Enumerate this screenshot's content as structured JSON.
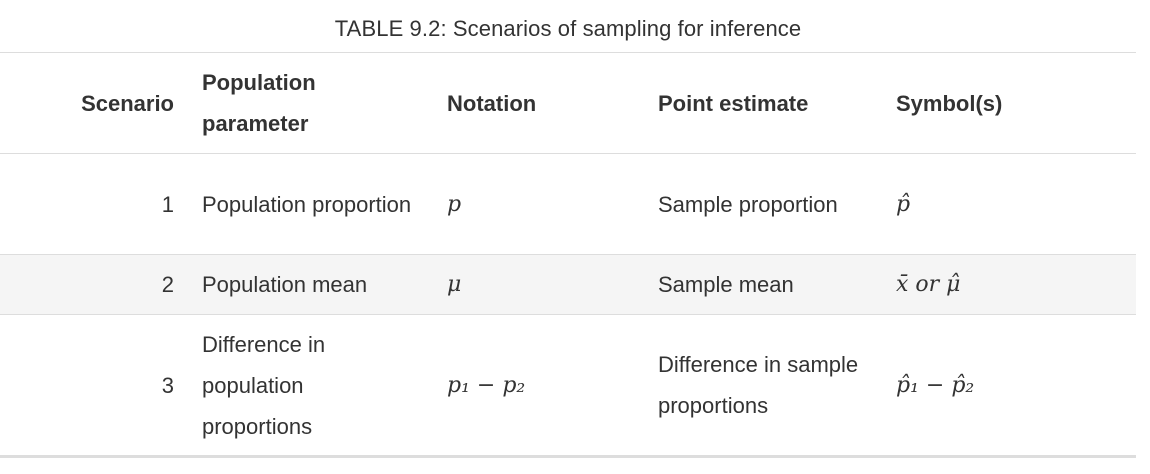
{
  "caption": "TABLE 9.2: Scenarios of sampling for inference",
  "table": {
    "headers": {
      "scenario": "Scenario",
      "parameter": "Population parameter",
      "notation": "Notation",
      "point_estimate": "Point estimate",
      "symbols": "Symbol(s)"
    },
    "rows": [
      {
        "scenario": "1",
        "parameter": "Population proportion",
        "notation": "p",
        "point_estimate": "Sample proportion",
        "symbols": "p̂"
      },
      {
        "scenario": "2",
        "parameter": "Population mean",
        "notation": "μ",
        "point_estimate": "Sample mean",
        "symbols": "x̄ or μ̂"
      },
      {
        "scenario": "3",
        "parameter": "Difference in population proportions",
        "notation": "p₁ − p₂",
        "point_estimate": "Difference in sample proportions",
        "symbols": "p̂₁ − p̂₂"
      }
    ]
  }
}
